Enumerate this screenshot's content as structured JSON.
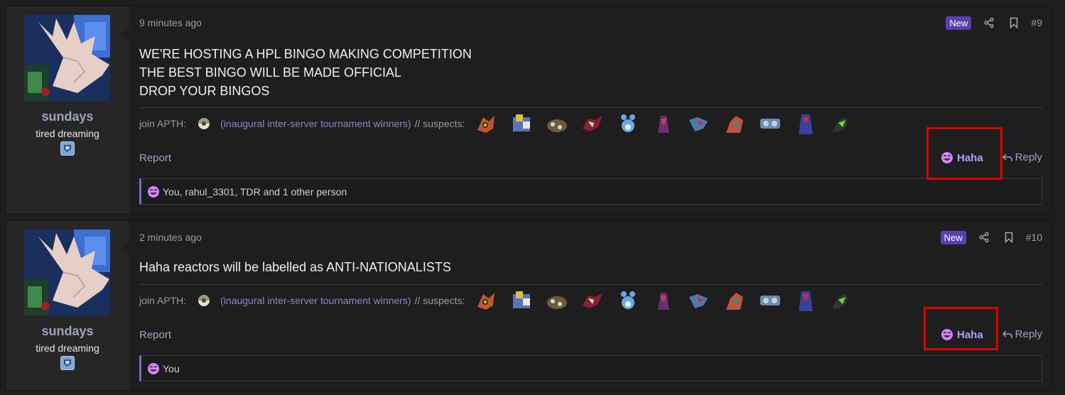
{
  "posts": [
    {
      "user": {
        "name": "sundays",
        "title": "tired dreaming"
      },
      "time": "9 minutes ago",
      "new_label": "New",
      "number": "#9",
      "body": [
        "WE'RE HOSTING A HPL BINGO MAKING COMPETITION",
        "THE BEST BINGO WILL BE MADE OFFICIAL",
        "DROP YOUR BINGOS"
      ],
      "signature": {
        "prefix": "join APTH:",
        "link": "(inaugural inter-server tournament winners)",
        "suffix": "// suspects:"
      },
      "actions": {
        "report": "Report",
        "reaction": "Haha",
        "reply": "Reply"
      },
      "reactions_summary": "You, rahul_3301, TDR and 1 other person"
    },
    {
      "user": {
        "name": "sundays",
        "title": "tired dreaming"
      },
      "time": "2 minutes ago",
      "new_label": "New",
      "number": "#10",
      "body": [
        "Haha reactors will be labelled as ANTI-NATIONALISTS"
      ],
      "signature": {
        "prefix": "join APTH:",
        "link": "(inaugural inter-server tournament winners)",
        "suffix": "// suspects:"
      },
      "actions": {
        "report": "Report",
        "reaction": "Haha",
        "reply": "Reply"
      },
      "reactions_summary": "You"
    }
  ],
  "icons": {
    "share": "share-icon",
    "bookmark": "bookmark-icon",
    "reply": "reply-icon",
    "reaction": "haha-emoji-icon",
    "user_badge": "user-badge-icon"
  },
  "colors": {
    "accent": "#b59bff",
    "new_badge": "#5b3fb0",
    "highlight": "#e00000",
    "link": "#8e86c8"
  }
}
